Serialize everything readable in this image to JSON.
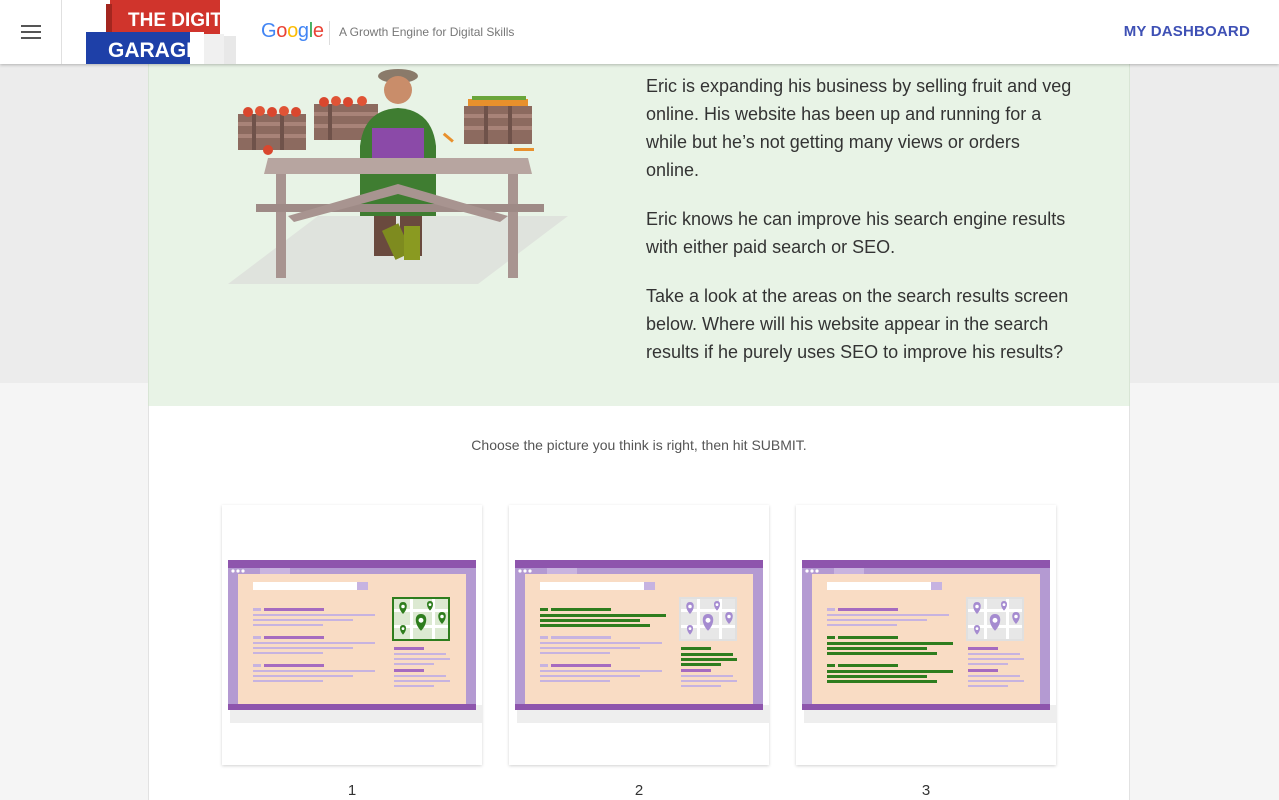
{
  "header": {
    "menu_icon": "hamburger-menu-icon",
    "logo_line1": "THE DIGITAL",
    "logo_line2": "GARAGE",
    "google_letters": [
      {
        "ch": "G",
        "color": "#4285F4"
      },
      {
        "ch": "o",
        "color": "#EA4335"
      },
      {
        "ch": "o",
        "color": "#FBBC05"
      },
      {
        "ch": "g",
        "color": "#4285F4"
      },
      {
        "ch": "l",
        "color": "#34A853"
      },
      {
        "ch": "e",
        "color": "#EA4335"
      }
    ],
    "tagline": "A Growth Engine for Digital Skills",
    "dashboard_label": "MY DASHBOARD"
  },
  "intro": {
    "paragraphs": [
      "Eric is expanding his business by selling fruit and veg online. His website has been up and running for a while but he’s not getting many views or orders online.",
      "Eric knows he can improve his search engine results with either paid search or SEO.",
      "Take a look at the areas on the search results screen below. Where will his website appear in the search results if he purely uses SEO to improve his results?"
    ]
  },
  "question": {
    "instruction": "Choose the picture you think is right, then hit SUBMIT.",
    "options": [
      {
        "label": "1",
        "highlight": "map"
      },
      {
        "label": "2",
        "highlight": "top-results"
      },
      {
        "label": "3",
        "highlight": "organic-results"
      }
    ]
  },
  "colors": {
    "accent": "#3f51b5",
    "intro_bg": "#e8f3e6",
    "highlight_green": "#2e7d1e",
    "browser_purple": "#9b59b6",
    "screen_peach": "#f9dcc4"
  }
}
